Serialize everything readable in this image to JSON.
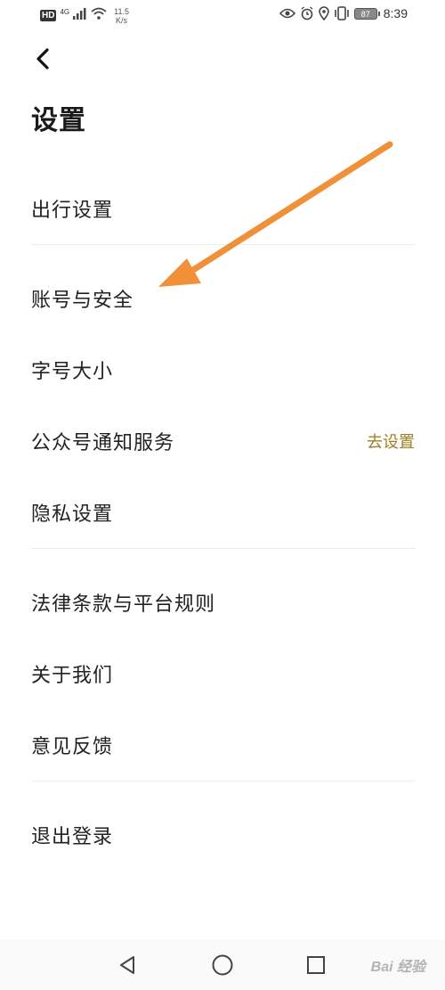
{
  "status_bar": {
    "hd": "HD",
    "network": "4G",
    "speed_value": "11.5",
    "speed_unit": "K/s",
    "battery": "87",
    "time": "8:39"
  },
  "header": {
    "title": "设置"
  },
  "menu": {
    "trip_settings": "出行设置",
    "account_security": "账号与安全",
    "font_size": "字号大小",
    "official_notifications": "公众号通知服务",
    "official_notifications_action": "去设置",
    "privacy_settings": "隐私设置",
    "legal_terms": "法律条款与平台规则",
    "about_us": "关于我们",
    "feedback": "意见反馈",
    "logout": "退出登录"
  },
  "watermark": "Bai 经验",
  "colors": {
    "accent": "#a27f22",
    "annotation_arrow": "#f0913a"
  }
}
